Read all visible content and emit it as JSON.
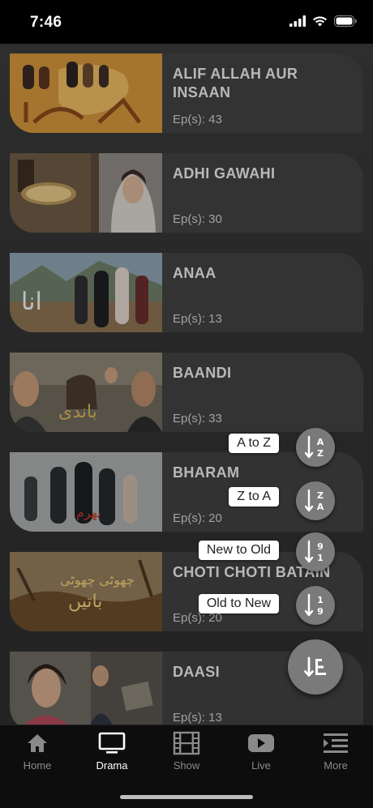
{
  "status_bar": {
    "time": "7:46"
  },
  "dramas": [
    {
      "title": "ALIF ALLAH AUR INSAAN",
      "episodes": "Ep(s): 43"
    },
    {
      "title": "ADHI GAWAHI",
      "episodes": "Ep(s): 30"
    },
    {
      "title": "ANAA",
      "episodes": "Ep(s): 13"
    },
    {
      "title": "BAANDI",
      "episodes": "Ep(s): 33"
    },
    {
      "title": "BHARAM",
      "episodes": "Ep(s): 20"
    },
    {
      "title": "CHOTI CHOTI BATAIN",
      "episodes": "Ep(s): 20"
    },
    {
      "title": "DAASI",
      "episodes": "Ep(s): 13"
    }
  ],
  "sort_menu": {
    "a_to_z": {
      "label": "A to Z",
      "icon": "sort-alpha-asc-icon",
      "glyph_top": "A",
      "glyph_bottom": "Z"
    },
    "z_to_a": {
      "label": "Z to A",
      "icon": "sort-alpha-desc-icon",
      "glyph_top": "Z",
      "glyph_bottom": "A"
    },
    "new_to_old": {
      "label": "New to Old",
      "icon": "sort-numeric-desc-icon",
      "glyph_top": "9",
      "glyph_bottom": "1"
    },
    "old_to_new": {
      "label": "Old to New",
      "icon": "sort-numeric-asc-icon",
      "glyph_top": "1",
      "glyph_bottom": "9"
    },
    "main_icon": "sort-icon"
  },
  "tabs": [
    {
      "label": "Home",
      "icon": "home-icon",
      "active": false
    },
    {
      "label": "Drama",
      "icon": "tv-icon",
      "active": true
    },
    {
      "label": "Show",
      "icon": "film-icon",
      "active": false
    },
    {
      "label": "Live",
      "icon": "play-icon",
      "active": false
    },
    {
      "label": "More",
      "icon": "menu-icon",
      "active": false
    }
  ],
  "colors": {
    "background": "#333333",
    "fab": "#7a7a7a",
    "tab_bar": "#0d0d0d",
    "active_tab": "#ffffff",
    "inactive_tab": "#8a8a8a"
  }
}
